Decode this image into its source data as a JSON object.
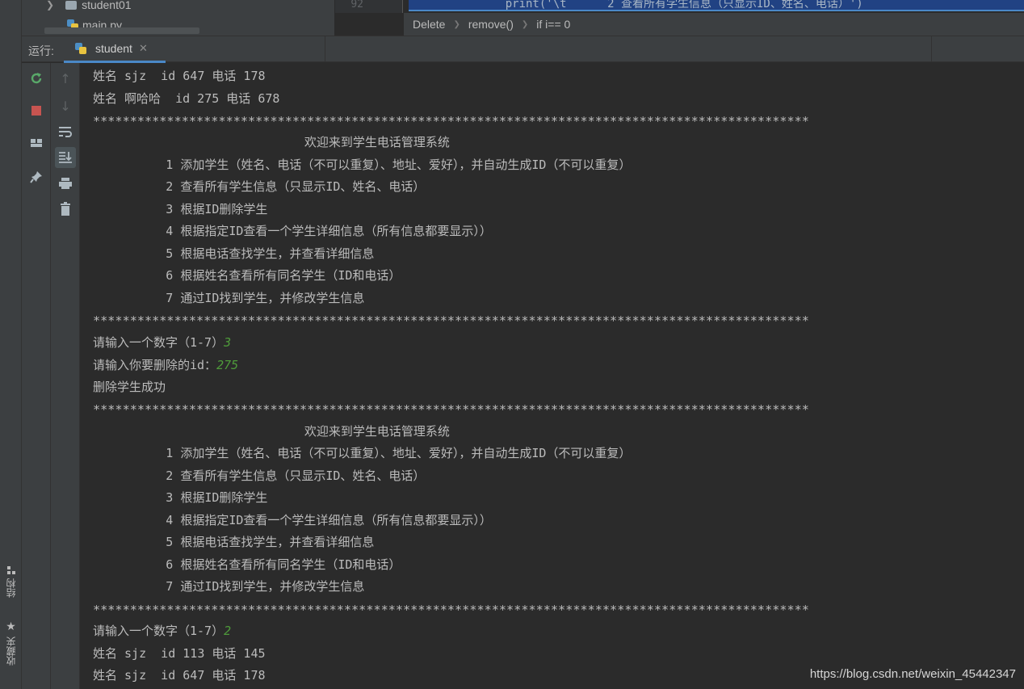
{
  "project_tree": {
    "folder": "student01",
    "file": "main.py"
  },
  "editor": {
    "line_number": "92",
    "code_partial": "    print('\\t      2 查看所有学生信息（只显示ID、姓名、电话）')"
  },
  "breadcrumb": [
    "Delete",
    "remove()",
    "if i== 0"
  ],
  "run_window": {
    "label": "运行:",
    "tab": "student"
  },
  "side_labels": {
    "structure": "结构",
    "favorites": "收藏夹"
  },
  "console": {
    "lines": [
      {
        "text": "姓名 sjz  id 647 电话 178"
      },
      {
        "text": "姓名 啊哈哈  id 275 电话 678"
      },
      {
        "text": "*************************************************************************************************",
        "stars": true
      },
      {
        "text": "                             欢迎来到学生电话管理系统"
      },
      {
        "text": "          1 添加学生（姓名、电话（不可以重复）、地址、爱好），并自动生成ID（不可以重复）"
      },
      {
        "text": "          2 查看所有学生信息（只显示ID、姓名、电话）"
      },
      {
        "text": "          3 根据ID删除学生"
      },
      {
        "text": "          4 根据指定ID查看一个学生详细信息（所有信息都要显示））"
      },
      {
        "text": "          5 根据电话查找学生，并查看详细信息"
      },
      {
        "text": "          6 根据姓名查看所有同名学生（ID和电话）"
      },
      {
        "text": "          7 通过ID找到学生，并修改学生信息"
      },
      {
        "text": "*************************************************************************************************",
        "stars": true
      },
      {
        "text": "请输入一个数字（1-7）",
        "input": "3"
      },
      {
        "text": "请输入你要删除的id：",
        "input": "275"
      },
      {
        "text": "删除学生成功"
      },
      {
        "text": "*************************************************************************************************",
        "stars": true
      },
      {
        "text": "                             欢迎来到学生电话管理系统"
      },
      {
        "text": "          1 添加学生（姓名、电话（不可以重复）、地址、爱好），并自动生成ID（不可以重复）"
      },
      {
        "text": "          2 查看所有学生信息（只显示ID、姓名、电话）"
      },
      {
        "text": "          3 根据ID删除学生"
      },
      {
        "text": "          4 根据指定ID查看一个学生详细信息（所有信息都要显示））"
      },
      {
        "text": "          5 根据电话查找学生，并查看详细信息"
      },
      {
        "text": "          6 根据姓名查看所有同名学生（ID和电话）"
      },
      {
        "text": "          7 通过ID找到学生，并修改学生信息"
      },
      {
        "text": "*************************************************************************************************",
        "stars": true
      },
      {
        "text": "请输入一个数字（1-7）",
        "input": "2"
      },
      {
        "text": "姓名 sjz  id 113 电话 145"
      },
      {
        "text": "姓名 sjz  id 647 电话 178"
      }
    ]
  },
  "watermark": "https://blog.csdn.net/weixin_45442347",
  "colors": {
    "console_bg": "#2b2b2b",
    "panel_bg": "#3c3f41",
    "input_text": "#4e9a3a",
    "tab_underline": "#4a88c7"
  }
}
